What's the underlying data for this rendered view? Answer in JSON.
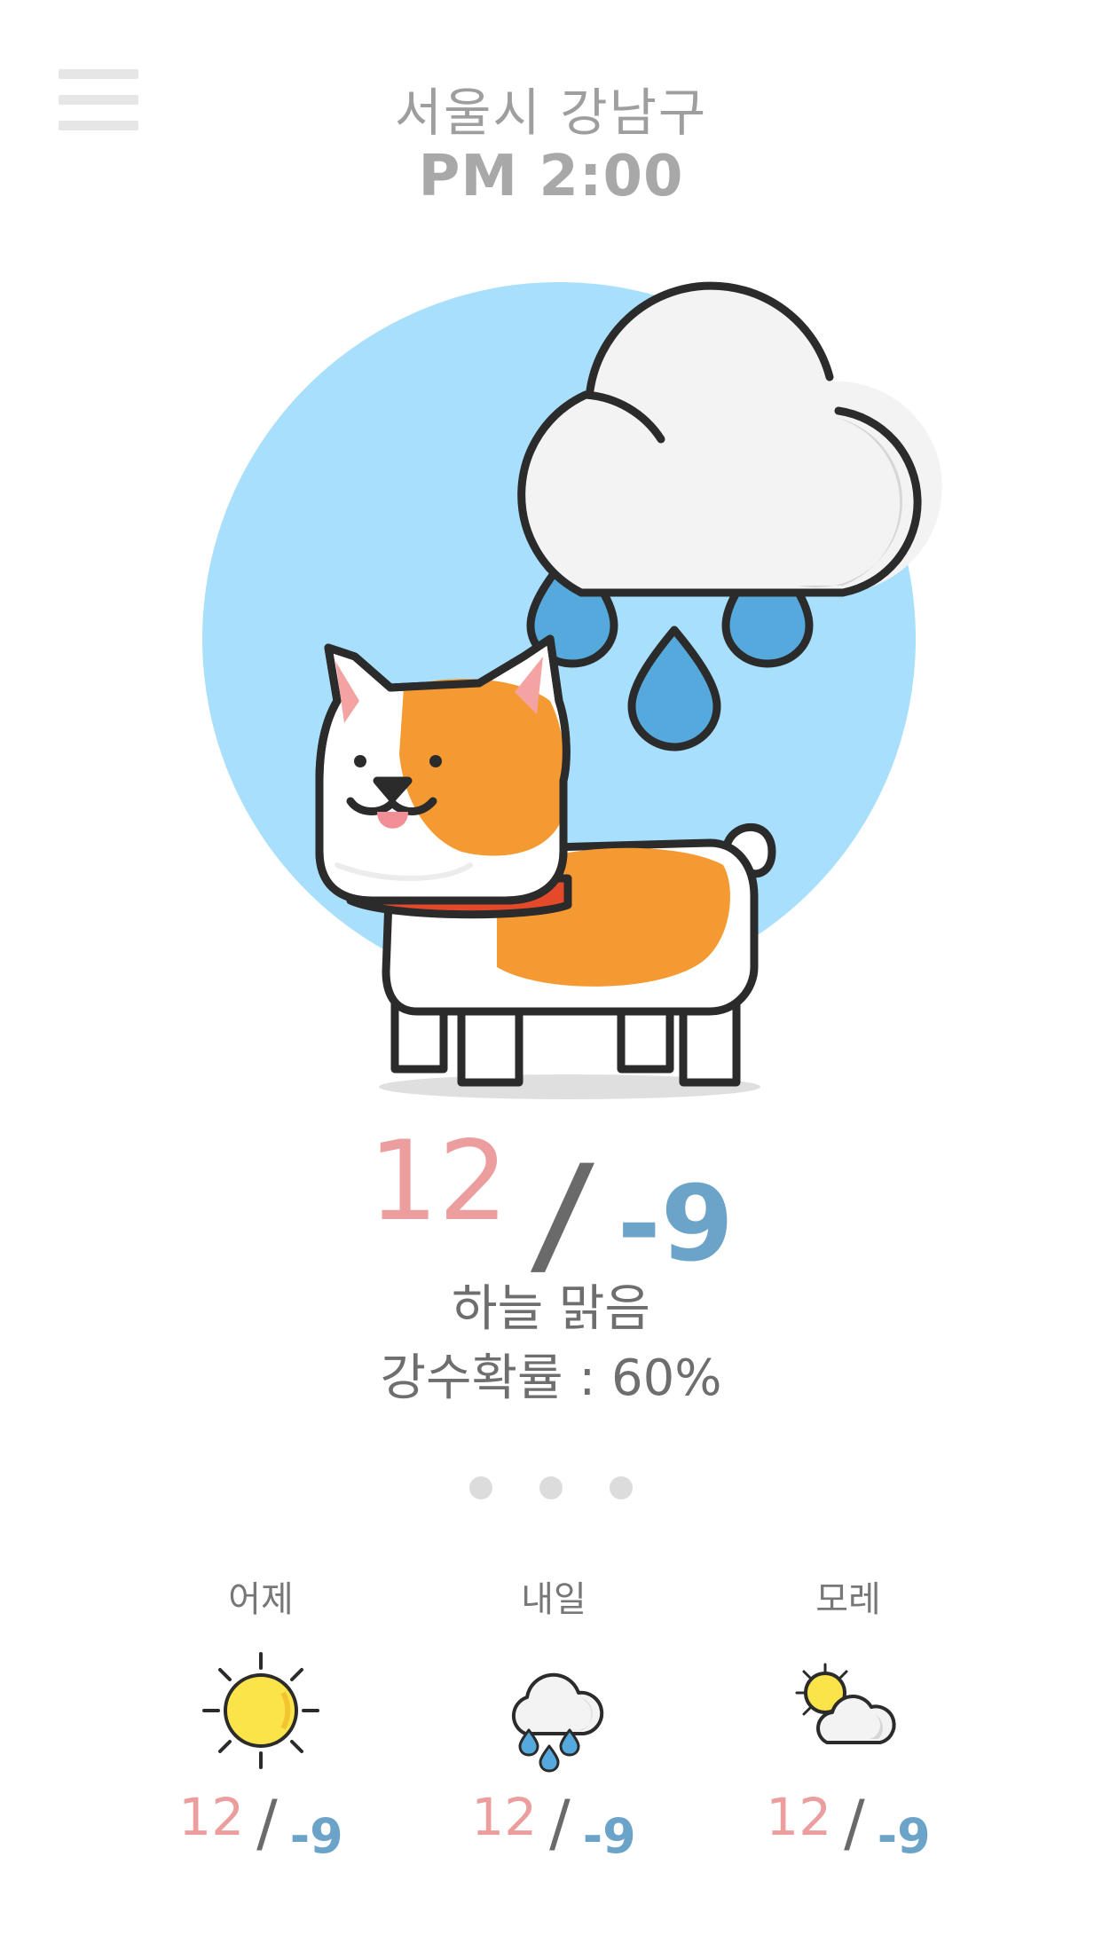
{
  "header": {
    "location": "서울시 강남구",
    "time": "PM 2:00",
    "menu_icon": "hamburger-menu-icon"
  },
  "current": {
    "high": "12",
    "separator": "/",
    "low": "-9",
    "description": "하늘 맑음",
    "rain_chance": "강수확률 : 60%",
    "illustration": "corgi-under-rain-cloud",
    "colors": {
      "high": "#ec9e9e",
      "low": "#6ca3c9",
      "circle": "#a8dffc"
    }
  },
  "pager": {
    "count": 3
  },
  "forecast": [
    {
      "day": "어제",
      "icon": "sun-icon",
      "high": "12",
      "separator": "/",
      "low": "-9"
    },
    {
      "day": "내일",
      "icon": "rain-cloud-icon",
      "high": "12",
      "separator": "/",
      "low": "-9"
    },
    {
      "day": "모레",
      "icon": "partly-cloudy-icon",
      "high": "12",
      "separator": "/",
      "low": "-9"
    }
  ]
}
